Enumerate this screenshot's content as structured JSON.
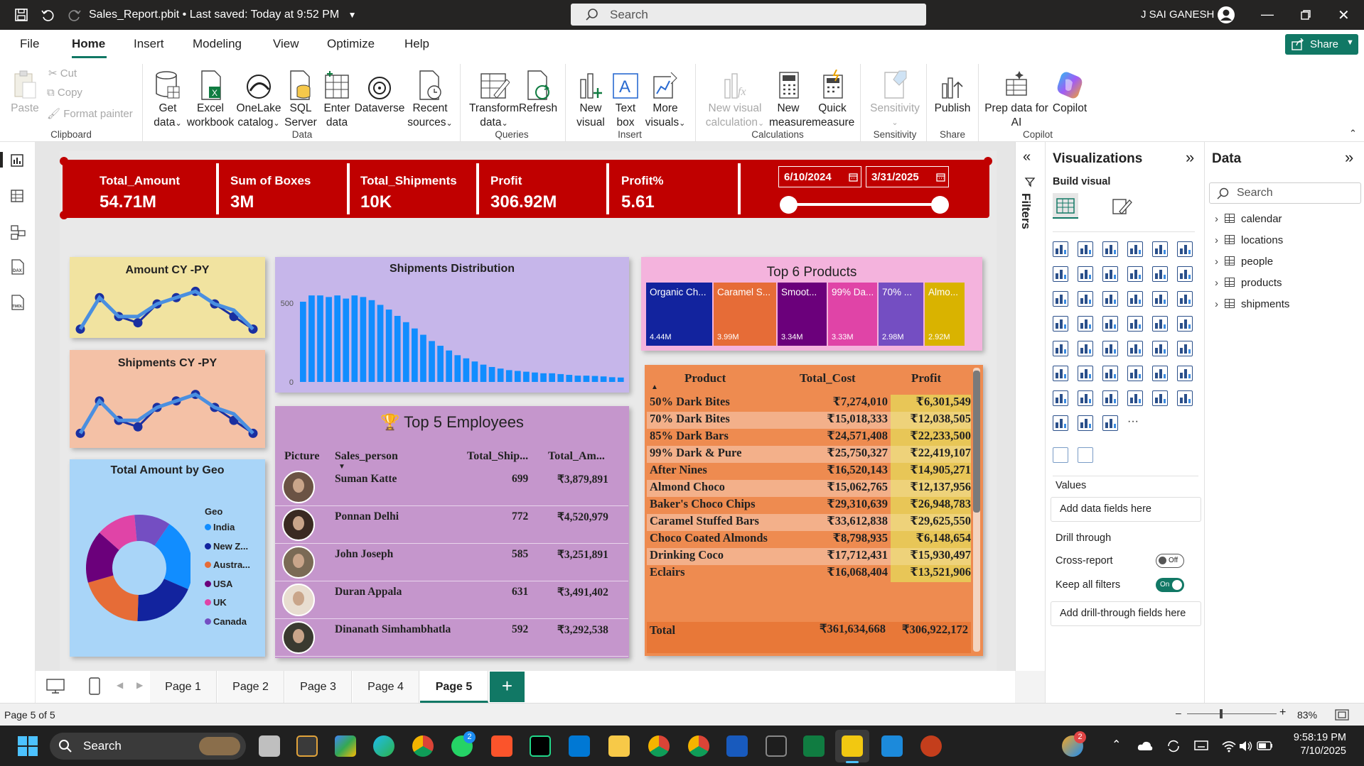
{
  "titlebar": {
    "file_title": "Sales_Report.pbit",
    "saved": "• Last saved: Today at 9:52 PM",
    "search_placeholder": "Search",
    "user": "J SAI GANESH"
  },
  "menu": {
    "items": [
      "File",
      "Home",
      "Insert",
      "Modeling",
      "View",
      "Optimize",
      "Help"
    ],
    "active": "Home",
    "share": "Share"
  },
  "ribbon": {
    "clipboard": {
      "paste": "Paste",
      "cut": "Cut",
      "copy": "Copy",
      "format_painter": "Format painter",
      "group": "Clipboard"
    },
    "data": {
      "get_data": [
        "Get",
        "data"
      ],
      "excel": [
        "Excel",
        "workbook"
      ],
      "onelake": [
        "OneLake",
        "catalog"
      ],
      "sql": [
        "SQL",
        "Server"
      ],
      "enter": [
        "Enter",
        "data"
      ],
      "dataverse": "Dataverse",
      "recent": [
        "Recent",
        "sources"
      ],
      "group": "Data"
    },
    "queries": {
      "transform": [
        "Transform",
        "data"
      ],
      "refresh": "Refresh",
      "group": "Queries"
    },
    "insert": {
      "new_visual": [
        "New",
        "visual"
      ],
      "text_box": [
        "Text",
        "box"
      ],
      "more_visuals": [
        "More",
        "visuals"
      ],
      "group": "Insert"
    },
    "calculations": {
      "new_visual_calc": [
        "New visual",
        "calculation"
      ],
      "new_measure": [
        "New",
        "measure"
      ],
      "quick_measure": [
        "Quick",
        "measure"
      ],
      "group": "Calculations"
    },
    "sensitivity": {
      "label": "Sensitivity",
      "group": "Sensitivity"
    },
    "share": {
      "publish": "Publish",
      "group": "Share"
    },
    "copilot": {
      "prep": [
        "Prep data for",
        "AI"
      ],
      "copilot": "Copilot",
      "group": "Copilot"
    }
  },
  "kpis": [
    {
      "title": "Total_Amount",
      "value": "54.71M"
    },
    {
      "title": "Sum of Boxes",
      "value": "3M"
    },
    {
      "title": "Total_Shipments",
      "value": "10K"
    },
    {
      "title": "Profit",
      "value": "306.92M"
    },
    {
      "title": "Profit%",
      "value": "5.61"
    }
  ],
  "date_slicer": {
    "start": "6/10/2024",
    "end": "3/31/2025"
  },
  "amount_cy_py": {
    "title": "Amount CY -PY"
  },
  "shipments_cy_py": {
    "title": "Shipments CY -PY"
  },
  "total_by_geo": {
    "title": "Total Amount by Geo",
    "legend_title": "Geo",
    "legend": [
      {
        "name": "India",
        "color": "#118dff"
      },
      {
        "name": "New Z...",
        "color": "#12239e"
      },
      {
        "name": "Austra...",
        "color": "#e66c37"
      },
      {
        "name": "USA",
        "color": "#6b007b"
      },
      {
        "name": "UK",
        "color": "#e044a7"
      },
      {
        "name": "Canada",
        "color": "#744ec2"
      }
    ]
  },
  "shipments_dist": {
    "title": "Shipments Distribution"
  },
  "top_products": {
    "title": "Top 6 Products",
    "items": [
      {
        "name": "Organic Ch...",
        "value": "4.44M",
        "color": "#12239e"
      },
      {
        "name": "Caramel S...",
        "value": "3.99M",
        "color": "#e66c37"
      },
      {
        "name": "Smoot...",
        "value": "3.34M",
        "color": "#6b007b"
      },
      {
        "name": "99% Da...",
        "value": "3.33M",
        "color": "#e044a7"
      },
      {
        "name": "70% ...",
        "value": "2.98M",
        "color": "#744ec2"
      },
      {
        "name": "Almo...",
        "value": "2.92M",
        "color": "#d9b300"
      }
    ]
  },
  "employees": {
    "title": "Top 5 Employees",
    "headers": [
      "Picture",
      "Sales_person",
      "Total_Ship...",
      "Total_Am..."
    ],
    "rows": [
      {
        "name": "Suman Katte",
        "ship": "699",
        "amount": "₹3,879,891"
      },
      {
        "name": "Ponnan Delhi",
        "ship": "772",
        "amount": "₹4,520,979"
      },
      {
        "name": "John Joseph",
        "ship": "585",
        "amount": "₹3,251,891"
      },
      {
        "name": "Duran Appala",
        "ship": "631",
        "amount": "₹3,491,402"
      },
      {
        "name": "Dinanath Simhambhatla",
        "ship": "592",
        "amount": "₹3,292,538"
      }
    ]
  },
  "product_table": {
    "headers": [
      "Product",
      "Total_Cost",
      "Profit"
    ],
    "rows": [
      {
        "p": "50% Dark Bites",
        "c": "₹7,274,010",
        "pr": "₹6,301,549"
      },
      {
        "p": "70% Dark Bites",
        "c": "₹15,018,333",
        "pr": "₹12,038,505"
      },
      {
        "p": "85% Dark Bars",
        "c": "₹24,571,408",
        "pr": "₹22,233,500"
      },
      {
        "p": "99% Dark & Pure",
        "c": "₹25,750,327",
        "pr": "₹22,419,107"
      },
      {
        "p": "After Nines",
        "c": "₹16,520,143",
        "pr": "₹14,905,271"
      },
      {
        "p": "Almond Choco",
        "c": "₹15,062,765",
        "pr": "₹12,137,956"
      },
      {
        "p": "Baker's Choco Chips",
        "c": "₹29,310,639",
        "pr": "₹26,948,783"
      },
      {
        "p": "Caramel Stuffed Bars",
        "c": "₹33,612,838",
        "pr": "₹29,625,550"
      },
      {
        "p": "Choco Coated Almonds",
        "c": "₹8,798,935",
        "pr": "₹6,148,654"
      },
      {
        "p": "Drinking Coco",
        "c": "₹17,712,431",
        "pr": "₹15,930,497"
      },
      {
        "p": "Eclairs",
        "c": "₹16,068,404",
        "pr": "₹13,521,906"
      }
    ],
    "total": {
      "label": "Total",
      "c": "₹361,634,668",
      "pr": "₹306,922,172"
    }
  },
  "filters_label": "Filters",
  "visualizations": {
    "title": "Visualizations",
    "build": "Build visual",
    "values": "Values",
    "add_fields": "Add data fields here",
    "drill": "Drill through",
    "cross_report": "Cross-report",
    "cross_state": "Off",
    "keep_filters": "Keep all filters",
    "keep_state": "On",
    "add_drill": "Add drill-through fields here"
  },
  "data_pane": {
    "title": "Data",
    "search_placeholder": "Search",
    "tables": [
      "calendar",
      "locations",
      "people",
      "products",
      "shipments"
    ]
  },
  "pages": [
    "Page 1",
    "Page 2",
    "Page 3",
    "Page 4",
    "Page 5"
  ],
  "active_page": "Page 5",
  "status": {
    "page": "Page 5 of 5",
    "zoom": "83%"
  },
  "taskbar": {
    "search": "Search",
    "time": "9:58:19 PM",
    "date": "7/10/2025",
    "whatsapp_badge": "2",
    "copilot_badge": "2"
  },
  "chart_data": [
    {
      "type": "line",
      "title": "Amount CY -PY",
      "series": [
        {
          "values": [
            -3,
            2,
            -1,
            -2,
            1,
            2,
            3,
            1,
            -1,
            -3
          ]
        },
        {
          "values": [
            -3,
            2,
            -1,
            -1,
            1,
            2,
            3,
            1,
            0,
            -3
          ]
        }
      ]
    },
    {
      "type": "line",
      "title": "Shipments CY -PY",
      "series": [
        {
          "values": [
            -3,
            2,
            -1,
            -2,
            1,
            2,
            3,
            1,
            -1,
            -3
          ]
        },
        {
          "values": [
            -3,
            2,
            -1,
            -1,
            1,
            2,
            3,
            1,
            0,
            -3
          ]
        }
      ]
    },
    {
      "type": "bar",
      "title": "Shipments Distribution",
      "ytick_labels": [
        "0",
        "500"
      ],
      "ylim": [
        0,
        650
      ],
      "values": [
        510,
        550,
        550,
        540,
        550,
        530,
        550,
        540,
        520,
        490,
        460,
        420,
        380,
        340,
        300,
        260,
        230,
        200,
        170,
        150,
        130,
        110,
        95,
        85,
        75,
        70,
        65,
        60,
        55,
        55,
        50,
        45,
        40,
        40,
        38,
        35,
        30,
        28
      ]
    },
    {
      "type": "pie",
      "title": "Total Amount by Geo",
      "labels": [
        "India",
        "New Z...",
        "Austra...",
        "USA",
        "UK",
        "Canada"
      ],
      "values": [
        22,
        19,
        20,
        16,
        12,
        11
      ]
    }
  ]
}
